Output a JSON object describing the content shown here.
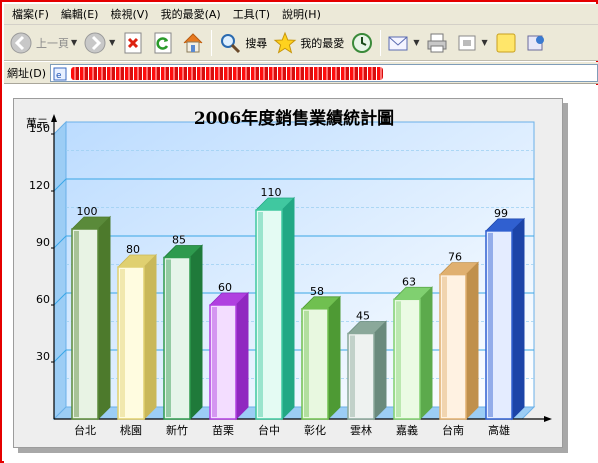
{
  "menu": {
    "items": [
      {
        "label": "檔案(F)"
      },
      {
        "label": "編輯(E)"
      },
      {
        "label": "檢視(V)"
      },
      {
        "label": "我的最愛(A)"
      },
      {
        "label": "工具(T)"
      },
      {
        "label": "說明(H)"
      }
    ]
  },
  "toolbar": {
    "back_label": "上一頁",
    "search_label": "搜尋",
    "favorites_label": "我的最愛"
  },
  "address": {
    "label": "網址(D)",
    "url": ""
  },
  "chart_data": {
    "type": "bar",
    "title": "2006年度銷售業績統計圖",
    "ylabel": "萬元",
    "xlabel": "",
    "categories": [
      "台北",
      "桃園",
      "新竹",
      "苗栗",
      "台中",
      "彰化",
      "雲林",
      "嘉義",
      "台南",
      "高雄"
    ],
    "values": [
      100,
      80,
      85,
      60,
      110,
      58,
      45,
      63,
      76,
      99
    ],
    "ylim": [
      0,
      150
    ],
    "yticks": [
      30,
      60,
      90,
      120,
      150
    ],
    "grid": true,
    "bar_colors": [
      {
        "face": "#e8f3e4",
        "edge": "#5a8a3a",
        "dark": "#4d7a2c"
      },
      {
        "face": "#fffce0",
        "edge": "#e0d070",
        "dark": "#c9b85a"
      },
      {
        "face": "#e6f5ea",
        "edge": "#2e9a4e",
        "dark": "#1f7a3a"
      },
      {
        "face": "#f3ddff",
        "edge": "#b040e0",
        "dark": "#9028c0"
      },
      {
        "face": "#e4fbf3",
        "edge": "#40c8a0",
        "dark": "#22a884"
      },
      {
        "face": "#e8f8e0",
        "edge": "#70c050",
        "dark": "#4e9a34"
      },
      {
        "face": "#eef2f0",
        "edge": "#8aa89a",
        "dark": "#6a8a7c"
      },
      {
        "face": "#ebfbe4",
        "edge": "#80d070",
        "dark": "#5caa4c"
      },
      {
        "face": "#fff2e2",
        "edge": "#e0b070",
        "dark": "#c0904c"
      },
      {
        "face": "#e4ecff",
        "edge": "#3060d0",
        "dark": "#1c44a8"
      }
    ]
  }
}
